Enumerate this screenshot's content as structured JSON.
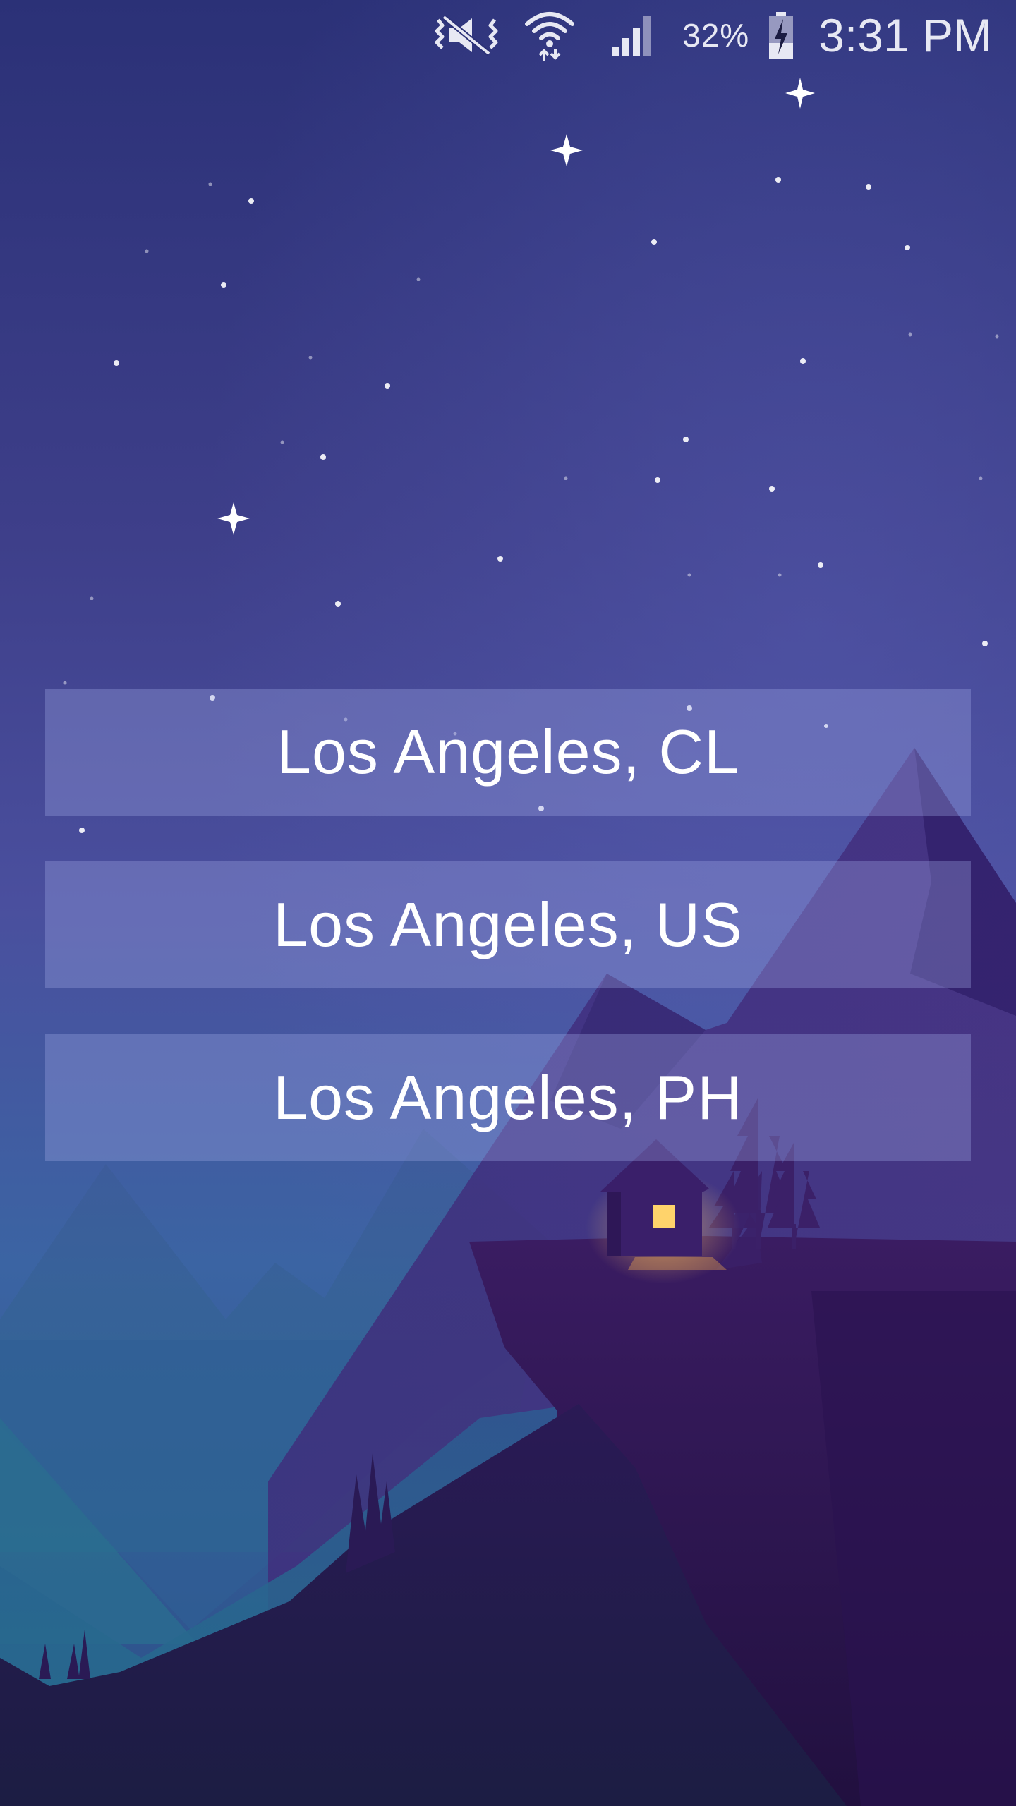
{
  "status_bar": {
    "icons": [
      "mute-vibrate-icon",
      "wifi-data-icon",
      "cell-signal-icon",
      "battery-charging-icon"
    ],
    "battery_percent": "32%",
    "time": "3:31 PM"
  },
  "city_results": [
    {
      "label": "Los Angeles, CL"
    },
    {
      "label": "Los Angeles, US"
    },
    {
      "label": "Los Angeles, PH"
    }
  ],
  "theme": {
    "sky_top": "#2b3178",
    "sky_mid": "#4a4f9e",
    "sky_low": "#3b6aa5",
    "mountain_purple": "#3a1f6a",
    "cliff_dark": "#28124a",
    "window_light": "#ffd36b"
  }
}
